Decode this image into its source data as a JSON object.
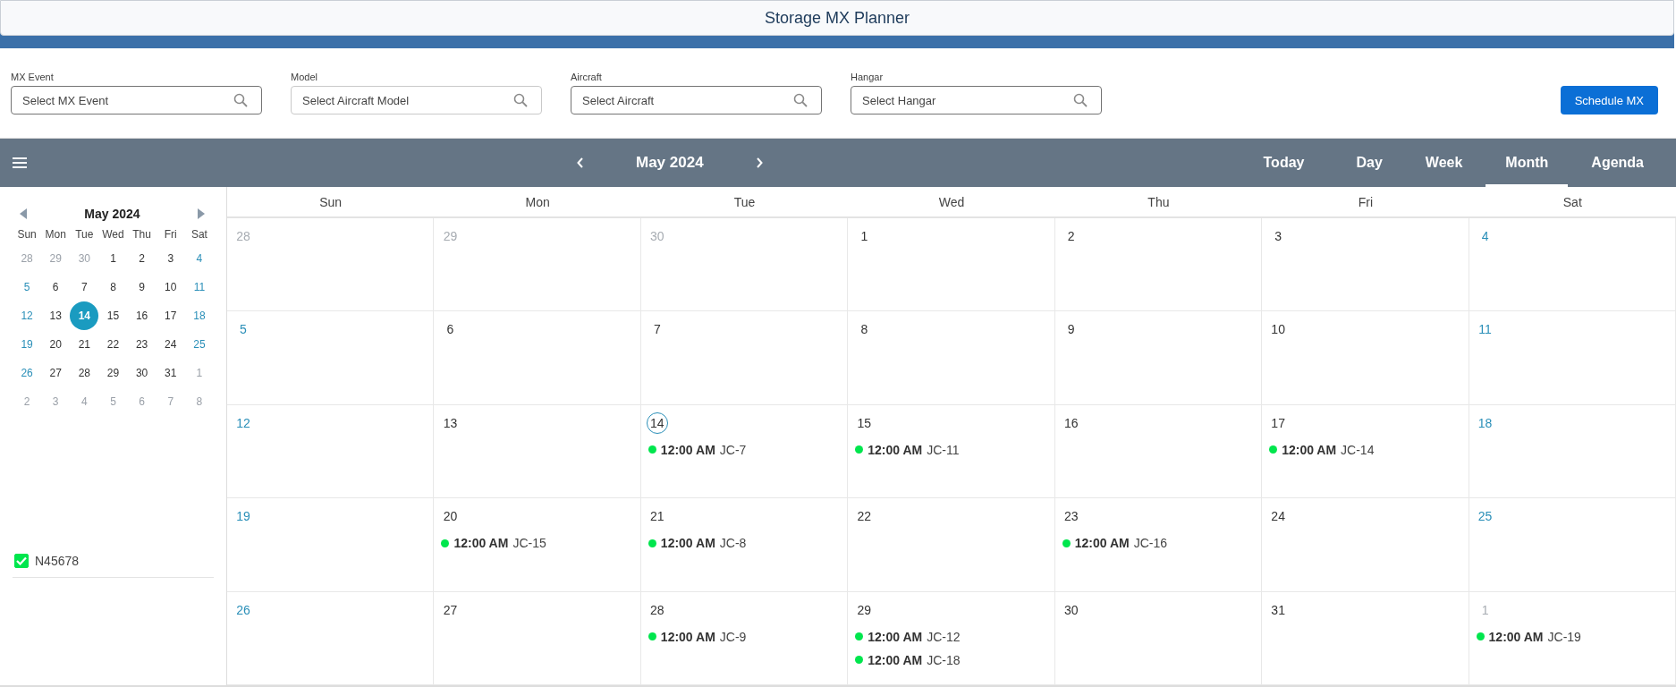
{
  "window": {
    "title": "Storage MX Planner"
  },
  "filters": [
    {
      "label": "MX Event",
      "placeholder": "Select MX Event",
      "disabled": false
    },
    {
      "label": "Model",
      "placeholder": "Select Aircraft Model",
      "disabled": true
    },
    {
      "label": "Aircraft",
      "placeholder": "Select Aircraft",
      "disabled": false
    },
    {
      "label": "Hangar",
      "placeholder": "Select Hangar",
      "disabled": false
    }
  ],
  "schedule_button": "Schedule MX",
  "toolbar": {
    "period": "May 2024",
    "views": [
      {
        "label": "Today",
        "selected": false
      },
      {
        "label": "Day",
        "selected": false
      },
      {
        "label": "Week",
        "selected": false
      },
      {
        "label": "Month",
        "selected": true
      },
      {
        "label": "Agenda",
        "selected": false
      }
    ]
  },
  "mini_calendar": {
    "title": "May 2024",
    "weekdays": [
      "Sun",
      "Mon",
      "Tue",
      "Wed",
      "Thu",
      "Fri",
      "Sat"
    ],
    "weeks": [
      [
        {
          "day": "28",
          "muted": true,
          "selected": false
        },
        {
          "day": "29",
          "muted": true,
          "selected": false
        },
        {
          "day": "30",
          "muted": true,
          "selected": false
        },
        {
          "day": "1",
          "muted": false,
          "weekend": false,
          "selected": false
        },
        {
          "day": "2",
          "muted": false,
          "weekend": false,
          "selected": false
        },
        {
          "day": "3",
          "muted": false,
          "weekend": false,
          "selected": false
        },
        {
          "day": "4",
          "muted": false,
          "weekend": true,
          "selected": false
        }
      ],
      [
        {
          "day": "5",
          "muted": false,
          "weekend": true,
          "selected": false
        },
        {
          "day": "6",
          "muted": false,
          "weekend": false,
          "selected": false
        },
        {
          "day": "7",
          "muted": false,
          "weekend": false,
          "selected": false
        },
        {
          "day": "8",
          "muted": false,
          "weekend": false,
          "selected": false
        },
        {
          "day": "9",
          "muted": false,
          "weekend": false,
          "selected": false
        },
        {
          "day": "10",
          "muted": false,
          "weekend": false,
          "selected": false
        },
        {
          "day": "11",
          "muted": false,
          "weekend": true,
          "selected": false
        }
      ],
      [
        {
          "day": "12",
          "muted": false,
          "weekend": true,
          "selected": false
        },
        {
          "day": "13",
          "muted": false,
          "weekend": false,
          "selected": false
        },
        {
          "day": "14",
          "muted": false,
          "weekend": false,
          "selected": true
        },
        {
          "day": "15",
          "muted": false,
          "weekend": false,
          "selected": false
        },
        {
          "day": "16",
          "muted": false,
          "weekend": false,
          "selected": false
        },
        {
          "day": "17",
          "muted": false,
          "weekend": false,
          "selected": false
        },
        {
          "day": "18",
          "muted": false,
          "weekend": true,
          "selected": false
        }
      ],
      [
        {
          "day": "19",
          "muted": false,
          "weekend": true,
          "selected": false
        },
        {
          "day": "20",
          "muted": false,
          "weekend": false,
          "selected": false
        },
        {
          "day": "21",
          "muted": false,
          "weekend": false,
          "selected": false
        },
        {
          "day": "22",
          "muted": false,
          "weekend": false,
          "selected": false
        },
        {
          "day": "23",
          "muted": false,
          "weekend": false,
          "selected": false
        },
        {
          "day": "24",
          "muted": false,
          "weekend": false,
          "selected": false
        },
        {
          "day": "25",
          "muted": false,
          "weekend": true,
          "selected": false
        }
      ],
      [
        {
          "day": "26",
          "muted": false,
          "weekend": true,
          "selected": false
        },
        {
          "day": "27",
          "muted": false,
          "weekend": false,
          "selected": false
        },
        {
          "day": "28",
          "muted": false,
          "weekend": false,
          "selected": false
        },
        {
          "day": "29",
          "muted": false,
          "weekend": false,
          "selected": false
        },
        {
          "day": "30",
          "muted": false,
          "weekend": false,
          "selected": false
        },
        {
          "day": "31",
          "muted": false,
          "weekend": false,
          "selected": false
        },
        {
          "day": "1",
          "muted": true,
          "selected": false
        }
      ],
      [
        {
          "day": "2",
          "muted": true,
          "selected": false
        },
        {
          "day": "3",
          "muted": true,
          "selected": false
        },
        {
          "day": "4",
          "muted": true,
          "selected": false
        },
        {
          "day": "5",
          "muted": true,
          "selected": false
        },
        {
          "day": "6",
          "muted": true,
          "selected": false
        },
        {
          "day": "7",
          "muted": true,
          "selected": false
        },
        {
          "day": "8",
          "muted": true,
          "selected": false
        }
      ]
    ]
  },
  "resources": [
    {
      "label": "N45678",
      "checked": true
    }
  ],
  "month": {
    "weekdays": [
      "Sun",
      "Mon",
      "Tue",
      "Wed",
      "Thu",
      "Fri",
      "Sat"
    ],
    "weeks": [
      [
        {
          "day": "28",
          "muted": true,
          "today": false
        },
        {
          "day": "29",
          "muted": true,
          "today": false
        },
        {
          "day": "30",
          "muted": true,
          "today": false
        },
        {
          "day": "1",
          "muted": false,
          "weekend": false,
          "today": false
        },
        {
          "day": "2",
          "muted": false,
          "weekend": false,
          "today": false
        },
        {
          "day": "3",
          "muted": false,
          "weekend": false,
          "today": false
        },
        {
          "day": "4",
          "muted": false,
          "weekend": true,
          "today": false
        }
      ],
      [
        {
          "day": "5",
          "muted": false,
          "weekend": true,
          "today": false
        },
        {
          "day": "6",
          "muted": false,
          "weekend": false,
          "today": false
        },
        {
          "day": "7",
          "muted": false,
          "weekend": false,
          "today": false
        },
        {
          "day": "8",
          "muted": false,
          "weekend": false,
          "today": false
        },
        {
          "day": "9",
          "muted": false,
          "weekend": false,
          "today": false
        },
        {
          "day": "10",
          "muted": false,
          "weekend": false,
          "today": false
        },
        {
          "day": "11",
          "muted": false,
          "weekend": true,
          "today": false
        }
      ],
      [
        {
          "day": "12",
          "muted": false,
          "weekend": true,
          "today": false
        },
        {
          "day": "13",
          "muted": false,
          "weekend": false,
          "today": false
        },
        {
          "day": "14",
          "muted": false,
          "weekend": false,
          "today": true,
          "events": [
            {
              "time": "12:00 AM",
              "title": "JC-7",
              "color": "#00e64d"
            }
          ]
        },
        {
          "day": "15",
          "muted": false,
          "weekend": false,
          "today": false,
          "events": [
            {
              "time": "12:00 AM",
              "title": "JC-11",
              "color": "#00e64d"
            }
          ]
        },
        {
          "day": "16",
          "muted": false,
          "weekend": false,
          "today": false
        },
        {
          "day": "17",
          "muted": false,
          "weekend": false,
          "today": false,
          "events": [
            {
              "time": "12:00 AM",
              "title": "JC-14",
              "color": "#00e64d"
            }
          ]
        },
        {
          "day": "18",
          "muted": false,
          "weekend": true,
          "today": false
        }
      ],
      [
        {
          "day": "19",
          "muted": false,
          "weekend": true,
          "today": false
        },
        {
          "day": "20",
          "muted": false,
          "weekend": false,
          "today": false,
          "events": [
            {
              "time": "12:00 AM",
              "title": "JC-15",
              "color": "#00e64d"
            }
          ]
        },
        {
          "day": "21",
          "muted": false,
          "weekend": false,
          "today": false,
          "events": [
            {
              "time": "12:00 AM",
              "title": "JC-8",
              "color": "#00e64d"
            }
          ]
        },
        {
          "day": "22",
          "muted": false,
          "weekend": false,
          "today": false
        },
        {
          "day": "23",
          "muted": false,
          "weekend": false,
          "today": false,
          "events": [
            {
              "time": "12:00 AM",
              "title": "JC-16",
              "color": "#00e64d"
            }
          ]
        },
        {
          "day": "24",
          "muted": false,
          "weekend": false,
          "today": false
        },
        {
          "day": "25",
          "muted": false,
          "weekend": true,
          "today": false
        }
      ],
      [
        {
          "day": "26",
          "muted": false,
          "weekend": true,
          "today": false
        },
        {
          "day": "27",
          "muted": false,
          "weekend": false,
          "today": false
        },
        {
          "day": "28",
          "muted": false,
          "weekend": false,
          "today": false,
          "events": [
            {
              "time": "12:00 AM",
              "title": "JC-9",
              "color": "#00e64d"
            }
          ]
        },
        {
          "day": "29",
          "muted": false,
          "weekend": false,
          "today": false,
          "events": [
            {
              "time": "12:00 AM",
              "title": "JC-12",
              "color": "#00e64d"
            },
            {
              "time": "12:00 AM",
              "title": "JC-18",
              "color": "#00e64d"
            }
          ]
        },
        {
          "day": "30",
          "muted": false,
          "weekend": false,
          "today": false
        },
        {
          "day": "31",
          "muted": false,
          "weekend": false,
          "today": false
        },
        {
          "day": "1",
          "muted": true,
          "today": false,
          "events": [
            {
              "time": "12:00 AM",
              "title": "JC-19",
              "color": "#00e64d"
            }
          ]
        }
      ]
    ]
  }
}
